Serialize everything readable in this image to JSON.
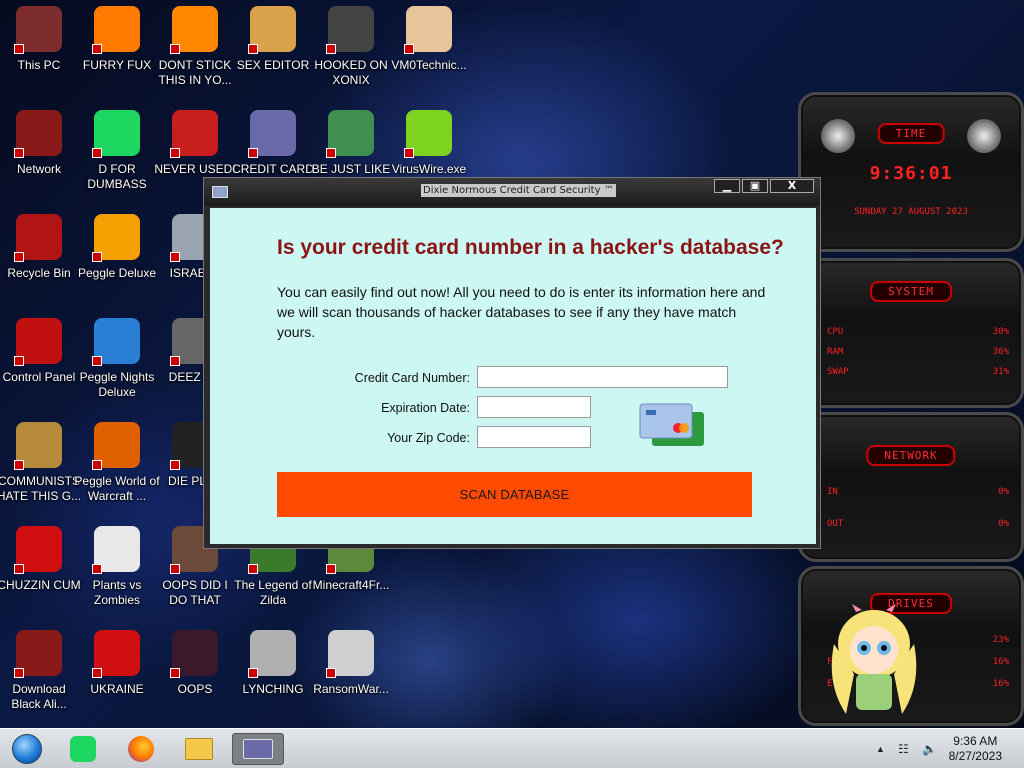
{
  "desktop_icons": [
    {
      "label": "This PC",
      "icon": "pc-icon",
      "color": "#7d2d2d"
    },
    {
      "label": "FURRY FUX",
      "icon": "firefox-icon",
      "color": "#ff7a00"
    },
    {
      "label": "DONT STICK THIS IN YO...",
      "icon": "vlc-cone-icon",
      "color": "#ff8800"
    },
    {
      "label": "SEX EDITOR",
      "icon": "hxd-icon",
      "color": "#d9a14a"
    },
    {
      "label": "HOOKED ON XONIX",
      "icon": "xonix-icon",
      "color": "#444444"
    },
    {
      "label": "VM0Technic...",
      "icon": "doctor-icon",
      "color": "#e8c49a"
    },
    {
      "label": "Network",
      "icon": "alienware-icon",
      "color": "#8a1a1a"
    },
    {
      "label": "D FOR DUMBASS",
      "icon": "spotify-icon",
      "color": "#1ed760"
    },
    {
      "label": "NEVER USED!",
      "icon": "dev-icon",
      "color": "#c81e1e"
    },
    {
      "label": "CREDIT CARD CHECKER",
      "icon": "credit-card-icon",
      "color": "#6a6aa8"
    },
    {
      "label": "BE JUST LIKE THE DUDE!",
      "icon": "gnome-icon",
      "color": "#3f8f50"
    },
    {
      "label": "VirusWire.exe",
      "icon": "limewire-icon",
      "color": "#7ed321"
    },
    {
      "label": "Recycle Bin",
      "icon": "recycle-bin-icon",
      "color": "#b01414"
    },
    {
      "label": "Peggle Deluxe",
      "icon": "peggle-icon",
      "color": "#f4a000"
    },
    {
      "label": "ISRAELS",
      "icon": "faucet-icon",
      "color": "#9aa4b0"
    },
    {
      "label": "Control Panel",
      "icon": "control-panel-icon",
      "color": "#c01010"
    },
    {
      "label": "Peggle Nights Deluxe",
      "icon": "peggle-nights-icon",
      "color": "#2a7fd4"
    },
    {
      "label": "DEEZ NU",
      "icon": "windows-stack-icon",
      "color": "#666666"
    },
    {
      "label": "COMMUNISTS HATE THIS G...",
      "icon": "money-bag-icon",
      "color": "#b58a3a"
    },
    {
      "label": "Peggle World of Warcraft ...",
      "icon": "peggle-wow-icon",
      "color": "#e06000"
    },
    {
      "label": "DIE PLEA",
      "icon": "de-icon",
      "color": "#222222"
    },
    {
      "label": "CHUZZIN CUM",
      "icon": "chuzzle-icon",
      "color": "#d01010"
    },
    {
      "label": "Plants vs Zombies",
      "icon": "pvz-icon",
      "color": "#e8e8e8"
    },
    {
      "label": "OOPS DID I DO THAT",
      "icon": "portrait-icon",
      "color": "#6b4a3a"
    },
    {
      "label": "The Legend of Zilda",
      "icon": "zelda-icon",
      "color": "#3a7a2a"
    },
    {
      "label": "Minecraft4Fr...",
      "icon": "minecraft-icon",
      "color": "#5a8a3a"
    },
    {
      "label": "Download Black Ali...",
      "icon": "alienware-dl-icon",
      "color": "#8a1a1a"
    },
    {
      "label": "UKRAINE",
      "icon": "radiation-icon",
      "color": "#d01010"
    },
    {
      "label": "OOPS",
      "icon": "flash-icon",
      "color": "#3a1a2a"
    },
    {
      "label": "LYNCHING",
      "icon": "noose-icon",
      "color": "#b0b0b0"
    },
    {
      "label": "RansomWar...",
      "icon": "skull-icon",
      "color": "#cfcfcf"
    }
  ],
  "gadget": {
    "time_title": "TIME",
    "time": "9:36:01",
    "date": "SUNDAY 27 AUGUST 2023",
    "system_title": "SYSTEM",
    "cpu_label": "CPU",
    "cpu_value": "30%",
    "ram_label": "RAM",
    "ram_value": "36%",
    "swap_label": "SWAP",
    "swap_value": "31%",
    "network_title": "NETWORK",
    "in_label": "IN",
    "in_value": "0%",
    "out_label": "OUT",
    "out_value": "0%",
    "drives_title": "DRIVES",
    "drive_c": "23%",
    "drive_f": "16%",
    "drive_e": "16%",
    "drive_f_label": "F",
    "drive_e_label": "E"
  },
  "window": {
    "title": "Dixie Normous Credit Card Security ™",
    "minimize": "▁",
    "maximize": "▣",
    "close": "X",
    "headline": "Is your credit card number in a hacker's database?",
    "intro": "You can easily find out now! All you need to do is enter its information here and we will scan thousands of hacker databases to see if any they have match yours.",
    "card_number_label": "Credit Card Number:",
    "card_number_value": "",
    "expiration_label": "Expiration Date:",
    "expiration_value": "",
    "zip_label": "Your Zip Code:",
    "zip_value": "",
    "scan_button": "SCAN DATABASE"
  },
  "taskbar": {
    "time": "9:36 AM",
    "date": "8/27/2023",
    "tray_arrow": "▲",
    "network_icon": "☷",
    "volume_icon": "🔈"
  },
  "colors": {
    "headline": "#8b1414",
    "scan_button": "#ff4a00",
    "client_bg": "#cdf7f3",
    "gadget_red": "#ff2020"
  }
}
